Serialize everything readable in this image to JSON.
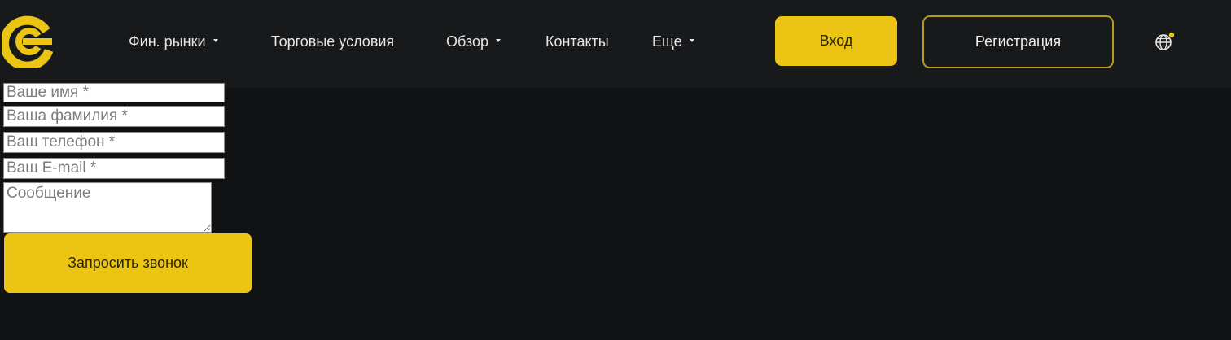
{
  "brand": {
    "logo_icon": "brand-c-logo-icon",
    "accent_color": "#ecc413"
  },
  "nav": {
    "items": [
      {
        "label": "Фин. рынки",
        "has_dropdown": true
      },
      {
        "label": "Торговые условия",
        "has_dropdown": false
      },
      {
        "label": "Обзор",
        "has_dropdown": true
      },
      {
        "label": "Контакты",
        "has_dropdown": false
      },
      {
        "label": "Еще",
        "has_dropdown": true
      }
    ]
  },
  "header": {
    "login_label": "Вход",
    "register_label": "Регистрация",
    "language_icon": "globe-icon"
  },
  "form": {
    "first_name": {
      "placeholder": "Ваше имя *",
      "value": ""
    },
    "last_name": {
      "placeholder": "Ваша фамилия *",
      "value": ""
    },
    "phone": {
      "placeholder": "Ваш телефон *",
      "value": ""
    },
    "email": {
      "placeholder": "Ваш E-mail *",
      "value": ""
    },
    "message": {
      "placeholder": "Сообщение",
      "value": ""
    },
    "submit_label": "Запросить звонок"
  }
}
